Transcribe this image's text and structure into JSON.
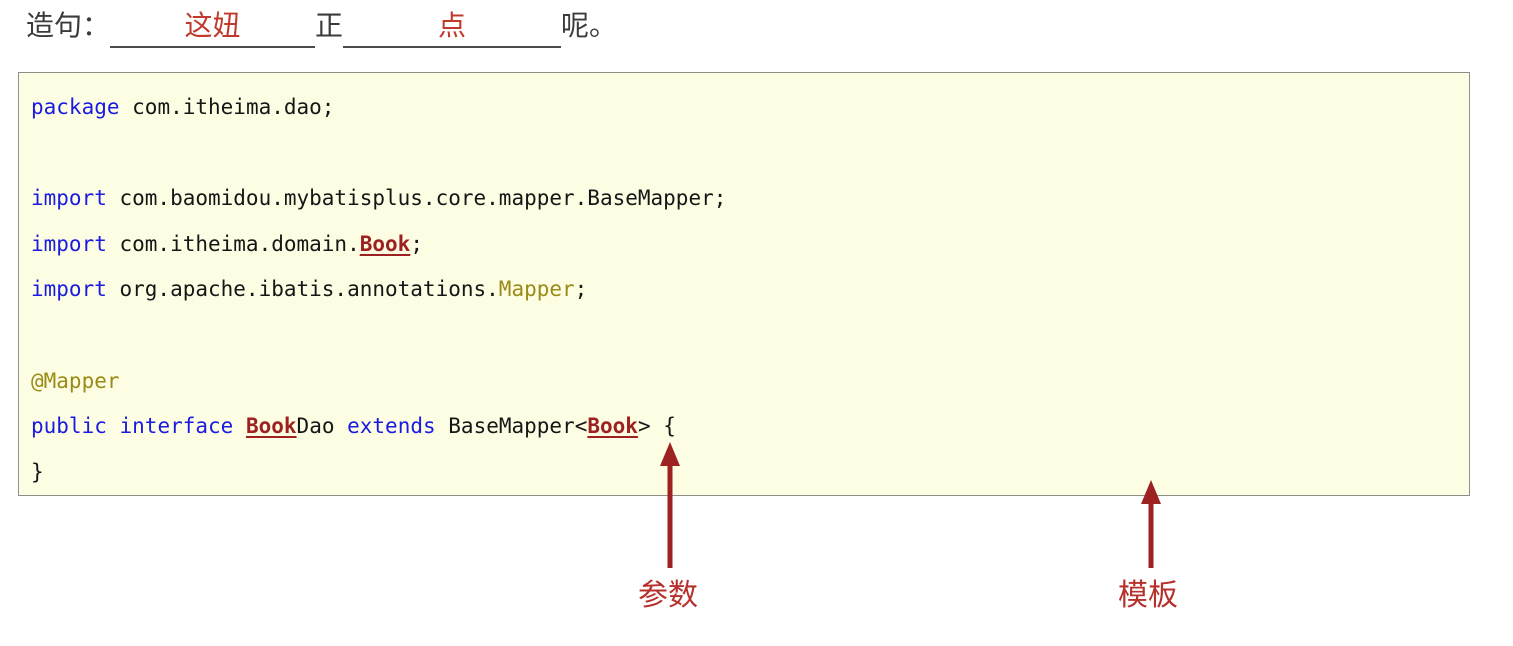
{
  "header": {
    "prefix": "造句：",
    "blank1_text": "这妞",
    "middle_text": "正",
    "blank2_text": "点",
    "suffix": "呢。",
    "blank_color": "#c0392b",
    "text_color": "#3b3b3b"
  },
  "code": {
    "background": "#fdfde4",
    "border_color": "#8f8f85",
    "keyword_color": "#1a1ae0",
    "annotation_color": "#9a8b16",
    "type_color": "#9e2121",
    "plain_color": "#161616",
    "lines": [
      {
        "id": "package-line",
        "tokens": [
          {
            "t": "package",
            "c": "kw"
          },
          {
            "t": " com.itheima.dao;",
            "c": "plain"
          }
        ]
      },
      {
        "id": "blank-line-1",
        "tokens": []
      },
      {
        "id": "import-basemapper-line",
        "tokens": [
          {
            "t": "import",
            "c": "kw"
          },
          {
            "t": " com.baomidou.mybatisplus.core.mapper.BaseMapper;",
            "c": "plain"
          }
        ]
      },
      {
        "id": "import-book-line",
        "tokens": [
          {
            "t": "import",
            "c": "kw"
          },
          {
            "t": " com.itheima.domain.",
            "c": "plain"
          },
          {
            "t": "Book",
            "c": "type-ul"
          },
          {
            "t": ";",
            "c": "plain"
          }
        ]
      },
      {
        "id": "import-mapper-line",
        "tokens": [
          {
            "t": "import",
            "c": "kw"
          },
          {
            "t": " org.apache.ibatis.annotations.",
            "c": "plain"
          },
          {
            "t": "Mapper",
            "c": "anno"
          },
          {
            "t": ";",
            "c": "plain"
          }
        ]
      },
      {
        "id": "blank-line-2",
        "tokens": []
      },
      {
        "id": "annotation-mapper-line",
        "tokens": [
          {
            "t": "@Mapper",
            "c": "anno"
          }
        ]
      },
      {
        "id": "interface-declaration-line",
        "tokens": [
          {
            "t": "public",
            "c": "kw"
          },
          {
            "t": " ",
            "c": "plain"
          },
          {
            "t": "interface",
            "c": "kw"
          },
          {
            "t": " ",
            "c": "plain"
          },
          {
            "t": "Book",
            "c": "type-ul"
          },
          {
            "t": "Dao ",
            "c": "plain"
          },
          {
            "t": "extends",
            "c": "kw"
          },
          {
            "t": " BaseMapper<",
            "c": "plain"
          },
          {
            "t": "Book",
            "c": "type-ul"
          },
          {
            "t": "> {",
            "c": "plain"
          }
        ]
      },
      {
        "id": "closing-brace-line",
        "tokens": [
          {
            "t": "}",
            "c": "plain"
          }
        ]
      }
    ]
  },
  "annotations": [
    {
      "id": "parameter-annotation",
      "label": "参数",
      "color": "#b7312c",
      "points_to": "Book generic type parameter"
    },
    {
      "id": "template-annotation",
      "label": "模板",
      "color": "#b7312c",
      "points_to": "BookDao mapper template"
    }
  ]
}
